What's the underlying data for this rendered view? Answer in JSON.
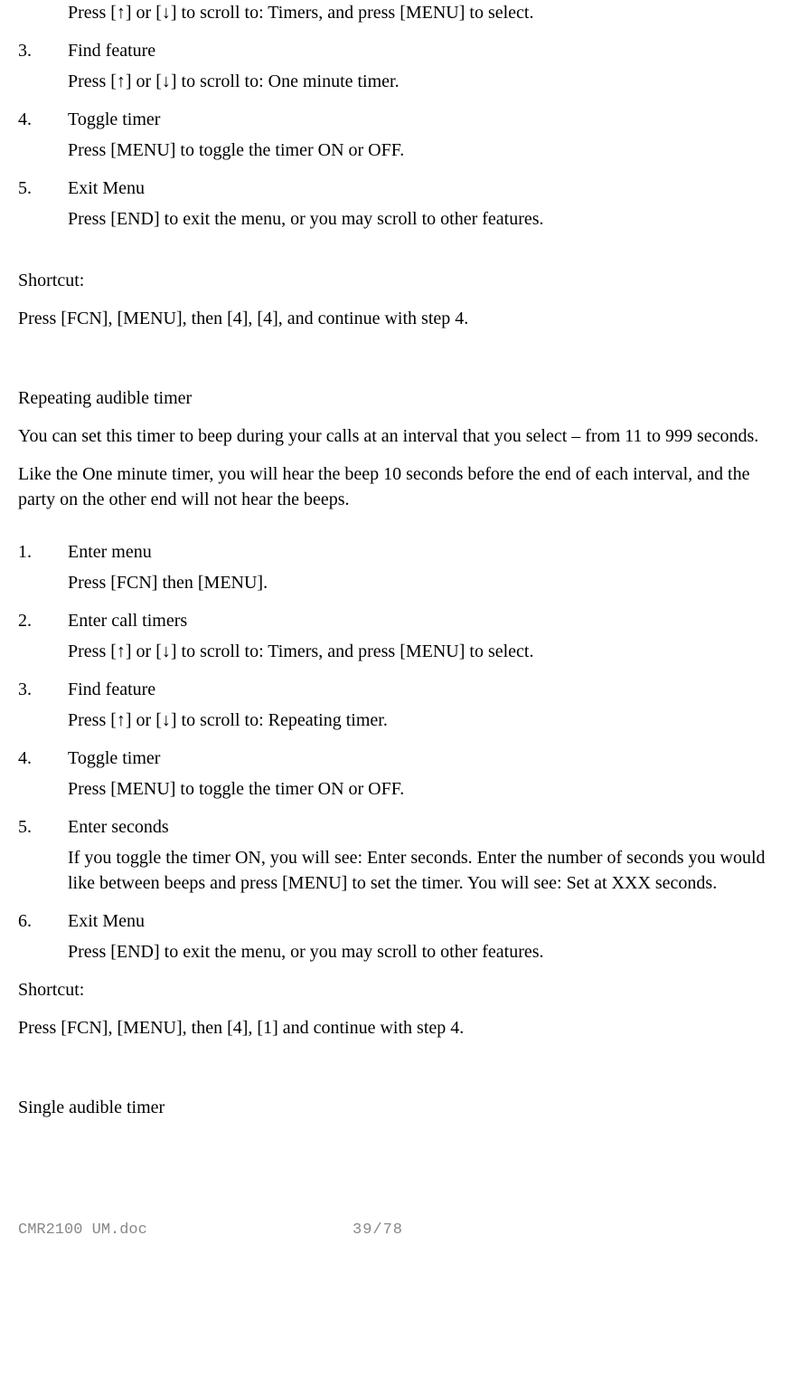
{
  "top": {
    "indent_line": "Press [↑] or [↓] to scroll to: Timers, and press [MENU] to select.",
    "steps": [
      {
        "num": "3.",
        "title": "Find feature",
        "desc": "Press [↑] or [↓] to scroll to: One minute timer."
      },
      {
        "num": "4.",
        "title": "Toggle timer",
        "desc": "Press [MENU] to toggle the timer ON or OFF."
      },
      {
        "num": "5.",
        "title": "Exit Menu",
        "desc": "Press [END] to exit the menu, or you may scroll to other features."
      }
    ]
  },
  "shortcut1": {
    "label": "Shortcut:",
    "text": "Press [FCN], [MENU], then [4], [4], and continue with step 4."
  },
  "section2": {
    "heading": "Repeating audible timer",
    "para1": "You can set this timer to beep during your calls at an interval that you select – from 11 to 999 seconds.",
    "para2": "Like the One minute timer, you will hear the beep 10 seconds before the end of each interval, and the party on the other end will not hear the beeps.",
    "steps": [
      {
        "num": "1.",
        "title": "Enter menu",
        "desc": "Press [FCN] then [MENU]."
      },
      {
        "num": "2.",
        "title": "Enter call timers",
        "desc": "Press [↑] or [↓] to scroll to: Timers, and press [MENU] to select."
      },
      {
        "num": "3.",
        "title": "Find feature",
        "desc": "Press [↑] or [↓] to scroll to: Repeating timer."
      },
      {
        "num": "4.",
        "title": "Toggle timer",
        "desc": "Press [MENU] to toggle the timer ON or OFF."
      },
      {
        "num": "5.",
        "title": "Enter seconds",
        "desc": "If you toggle the timer ON, you will see: Enter seconds. Enter the number of seconds you would like between beeps and press [MENU] to set the timer. You will see: Set at XXX seconds."
      },
      {
        "num": "6.",
        "title": "Exit Menu",
        "desc": "Press [END] to exit the menu, or you may scroll to other features."
      }
    ]
  },
  "shortcut2": {
    "label": "Shortcut:",
    "text": "Press [FCN], [MENU], then [4], [1] and continue with step 4."
  },
  "section3": {
    "heading": "Single audible timer"
  },
  "footer": {
    "doc": "CMR2100 UM.doc",
    "page": "39/78"
  }
}
